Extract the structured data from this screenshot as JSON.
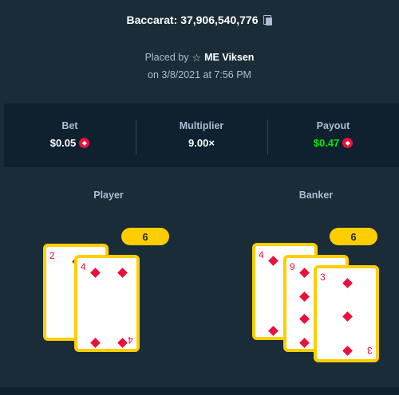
{
  "header": {
    "title": "Baccarat: 37,906,540,776",
    "placed_prefix": "Placed by",
    "username": "ME Viksen",
    "date": "on 3/8/2021 at 7:56 PM"
  },
  "stats": {
    "bet_label": "Bet",
    "bet_value": "$0.05",
    "multiplier_label": "Multiplier",
    "multiplier_value": "9.00×",
    "payout_label": "Payout",
    "payout_value": "$0.47",
    "currency_icon": "ruby-coin-icon"
  },
  "player": {
    "label": "Player",
    "score": "6",
    "cards": [
      {
        "rank": "2",
        "suit": "diamonds"
      },
      {
        "rank": "4",
        "suit": "diamonds"
      }
    ]
  },
  "banker": {
    "label": "Banker",
    "score": "6",
    "cards": [
      {
        "rank": "4",
        "suit": "diamonds"
      },
      {
        "rank": "9",
        "suit": "diamonds"
      },
      {
        "rank": "3",
        "suit": "diamonds"
      }
    ]
  },
  "colors": {
    "background": "#1a2c38",
    "panel": "#0f212e",
    "accent": "#ffce00",
    "suit_red": "#e9113c",
    "payout_green": "#00e701"
  }
}
